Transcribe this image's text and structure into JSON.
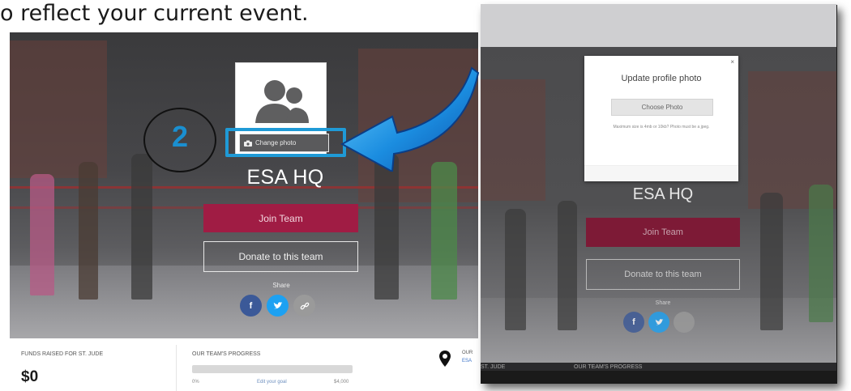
{
  "caption": {
    "text": "o reflect your current event."
  },
  "left_page": {
    "change_photo_label": "Change photo",
    "step_number": "2",
    "team_name": "ESA HQ",
    "join_button": "Join Team",
    "donate_button": "Donate to this team",
    "share_label": "Share",
    "share_buttons": [
      "f",
      "t",
      "link"
    ],
    "stats": {
      "funds_label": "FUNDS RAISED FOR ST. JUDE",
      "funds_value": "$0",
      "progress_label": "OUR TEAM'S PROGRESS",
      "progress_fraction": 0,
      "progress_percent": "0%",
      "edit_goal": "Edit your goal",
      "goal_amount": "$4,000",
      "our_label": "OUR",
      "esa_link": "ESA"
    }
  },
  "right_page": {
    "modal": {
      "close": "×",
      "title": "Update profile photo",
      "choose_button": "Choose Photo",
      "help_text": "Maximum size is 4mb or 10kb? Photo must be a jpeg."
    },
    "team_name": "ESA HQ",
    "join_button": "Join Team",
    "donate_button": "Donate to this team",
    "share_label": "Share",
    "stats_left": "ST. JUDE",
    "stats_right": "OUR TEAM'S PROGRESS"
  },
  "colors": {
    "accent_blue": "#1f9ad6",
    "join_red": "#a01c44",
    "facebook": "#3b5998",
    "twitter": "#1da1f2",
    "link_gray": "#9a9a9a"
  },
  "icons": [
    "camera-icon",
    "user-group-icon",
    "location-pin-icon",
    "facebook-icon",
    "twitter-icon",
    "link-icon",
    "close-icon",
    "curved-arrow-icon"
  ]
}
